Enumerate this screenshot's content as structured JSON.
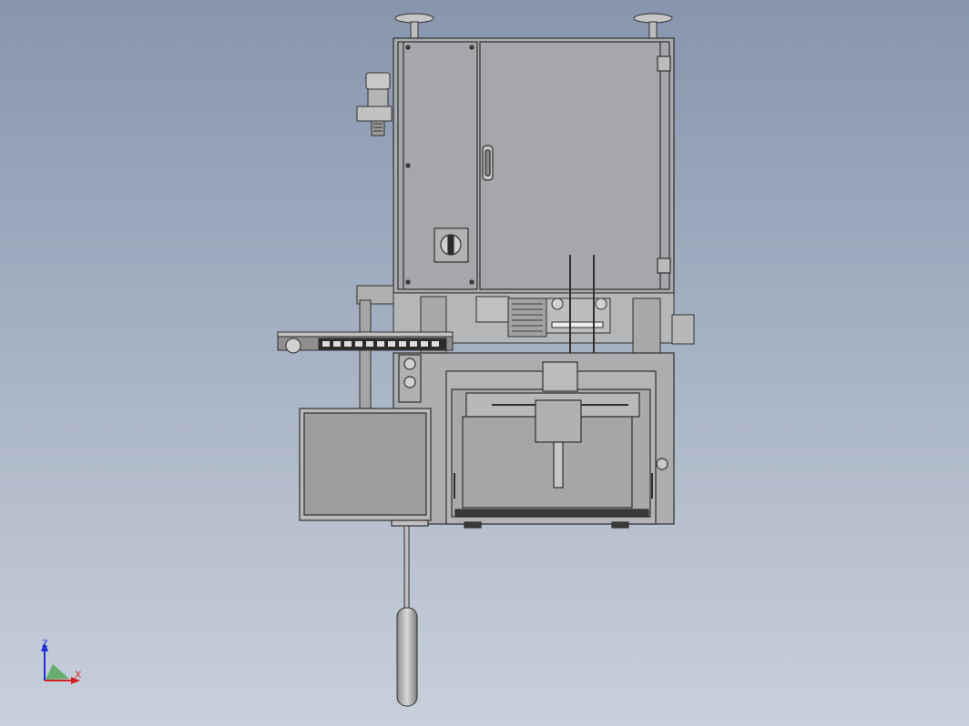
{
  "viewport": {
    "background_top": "#8796ad",
    "background_bottom": "#c8d0db",
    "body_color": "#a9aaad",
    "edge_color": "#303030",
    "screen_color": "#9d9d9d"
  },
  "triad": {
    "z_label": "Z",
    "x_label": "X",
    "z_color": "#1f2fd6",
    "x_color": "#d42020",
    "y_color": "#2a9a2a"
  }
}
